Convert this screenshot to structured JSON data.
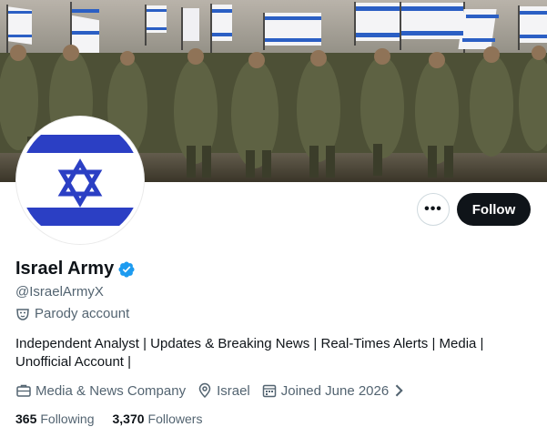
{
  "profile": {
    "display_name": "Israel Army",
    "handle": "@IsraelArmyX",
    "parody_label": "Parody account",
    "bio": "Independent Analyst | Updates & Breaking News | Real-Times Alerts | Media | Unofficial Account |",
    "category": "Media & News Company",
    "location": "Israel",
    "joined": "Joined June 2026",
    "following_count": "365",
    "following_label": "Following",
    "followers_count": "3,370",
    "followers_label": "Followers",
    "verified": true
  },
  "actions": {
    "more_label": "•••",
    "follow_label": "Follow"
  },
  "icons": {
    "verified": "verified-badge-icon",
    "parody": "mask-icon",
    "category": "briefcase-icon",
    "location": "location-pin-icon",
    "joined": "calendar-icon",
    "joined_chevron": "chevron-right-icon",
    "more": "more-horizontal-icon"
  },
  "colors": {
    "accent_blue": "#1d9bf0",
    "flag_blue": "#2b3fc4",
    "follow_button": "#0f1419",
    "secondary_text": "#536471"
  }
}
